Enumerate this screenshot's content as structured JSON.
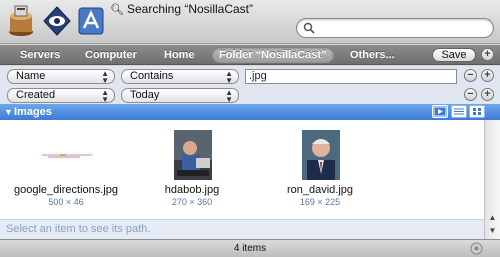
{
  "window": {
    "title": "Searching “NosillaCast”",
    "toolbar_icons": [
      "app-icon",
      "eye-icon",
      "application-icon"
    ]
  },
  "search": {
    "value": "",
    "placeholder": ""
  },
  "scope_bar": {
    "items": [
      {
        "label": "Servers"
      },
      {
        "label": "Computer"
      },
      {
        "label": "Home"
      },
      {
        "label": "Folder “NosillaCast”",
        "selected": true
      },
      {
        "label": "Others..."
      }
    ],
    "save_label": "Save",
    "add_symbol": "+"
  },
  "criteria": [
    {
      "attribute": "Name",
      "operator": "Contains",
      "value": ".jpg",
      "remove": "−",
      "add": "+"
    },
    {
      "attribute": "Created",
      "operator": "Today",
      "remove": "−",
      "add": "+"
    }
  ],
  "results": {
    "group": "Images",
    "items": [
      {
        "name": "google_directions.jpg",
        "dims": "500 × 46"
      },
      {
        "name": "hdabob.jpg",
        "dims": "270 × 360"
      },
      {
        "name": "ron_david.jpg",
        "dims": "169 × 225"
      }
    ],
    "path_hint": "Select an item to see its path."
  },
  "status": {
    "count": "4 items"
  },
  "colors": {
    "accent": "#3b7ad6",
    "scope_bar": "#7d7d7d"
  }
}
